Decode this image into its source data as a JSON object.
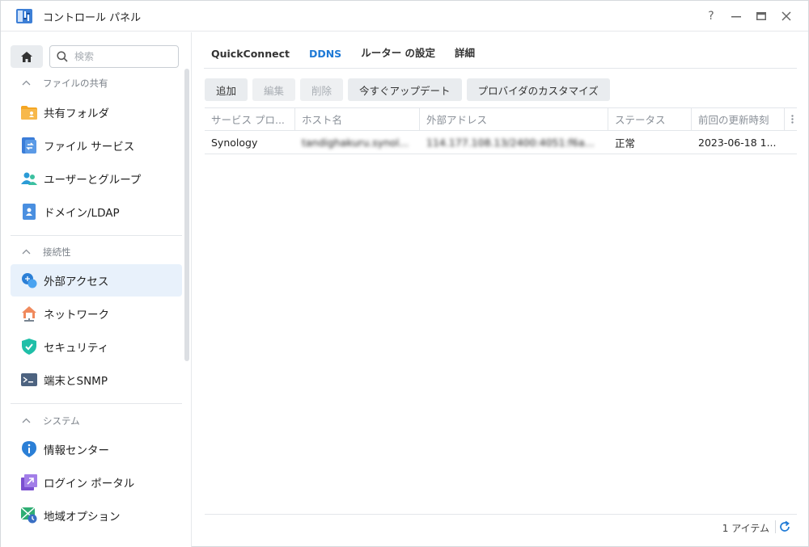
{
  "window": {
    "title": "コントロール パネル",
    "controls": {
      "help": "?",
      "minimize": "—",
      "maximize": "▭",
      "close": "✕"
    }
  },
  "sidebar": {
    "search_placeholder": "検索",
    "sections": [
      {
        "label": "ファイルの共有"
      },
      {
        "label": "接続性"
      },
      {
        "label": "システム"
      }
    ],
    "items": [
      {
        "label": "共有フォルダ",
        "icon": "shared-folder-icon"
      },
      {
        "label": "ファイル サービス",
        "icon": "file-services-icon"
      },
      {
        "label": "ユーザーとグループ",
        "icon": "users-groups-icon"
      },
      {
        "label": "ドメイン/LDAP",
        "icon": "domain-ldap-icon"
      },
      {
        "label": "外部アクセス",
        "icon": "external-access-icon",
        "active": true
      },
      {
        "label": "ネットワーク",
        "icon": "network-icon"
      },
      {
        "label": "セキュリティ",
        "icon": "security-shield-icon"
      },
      {
        "label": "端末とSNMP",
        "icon": "terminal-icon"
      },
      {
        "label": "情報センター",
        "icon": "info-center-icon"
      },
      {
        "label": "ログイン ポータル",
        "icon": "login-portal-icon"
      },
      {
        "label": "地域オプション",
        "icon": "regional-options-icon"
      }
    ]
  },
  "tabs": [
    {
      "label": "QuickConnect"
    },
    {
      "label": "DDNS",
      "active": true
    },
    {
      "label": "ルーター の設定"
    },
    {
      "label": "詳細"
    }
  ],
  "toolbar": {
    "add": "追加",
    "edit": "編集",
    "delete": "削除",
    "update_now": "今すぐアップデート",
    "customize_provider": "プロバイダのカスタマイズ"
  },
  "table": {
    "columns": [
      "サービス プロ...",
      "ホスト名",
      "外部アドレス",
      "ステータス",
      "前回の更新時刻"
    ],
    "rows": [
      {
        "provider": "Synology",
        "hostname": "tandighakuru.synol...",
        "external_address": "114.177.108.13/2400:4051:f6a...",
        "status": "正常",
        "last_update": "2023-06-18 1..."
      }
    ]
  },
  "footer": {
    "count": "1 アイテム"
  },
  "colors": {
    "accent": "#1f7ad6",
    "status_ok": "#2a9a3b",
    "active_bg": "#e8f1fb"
  }
}
